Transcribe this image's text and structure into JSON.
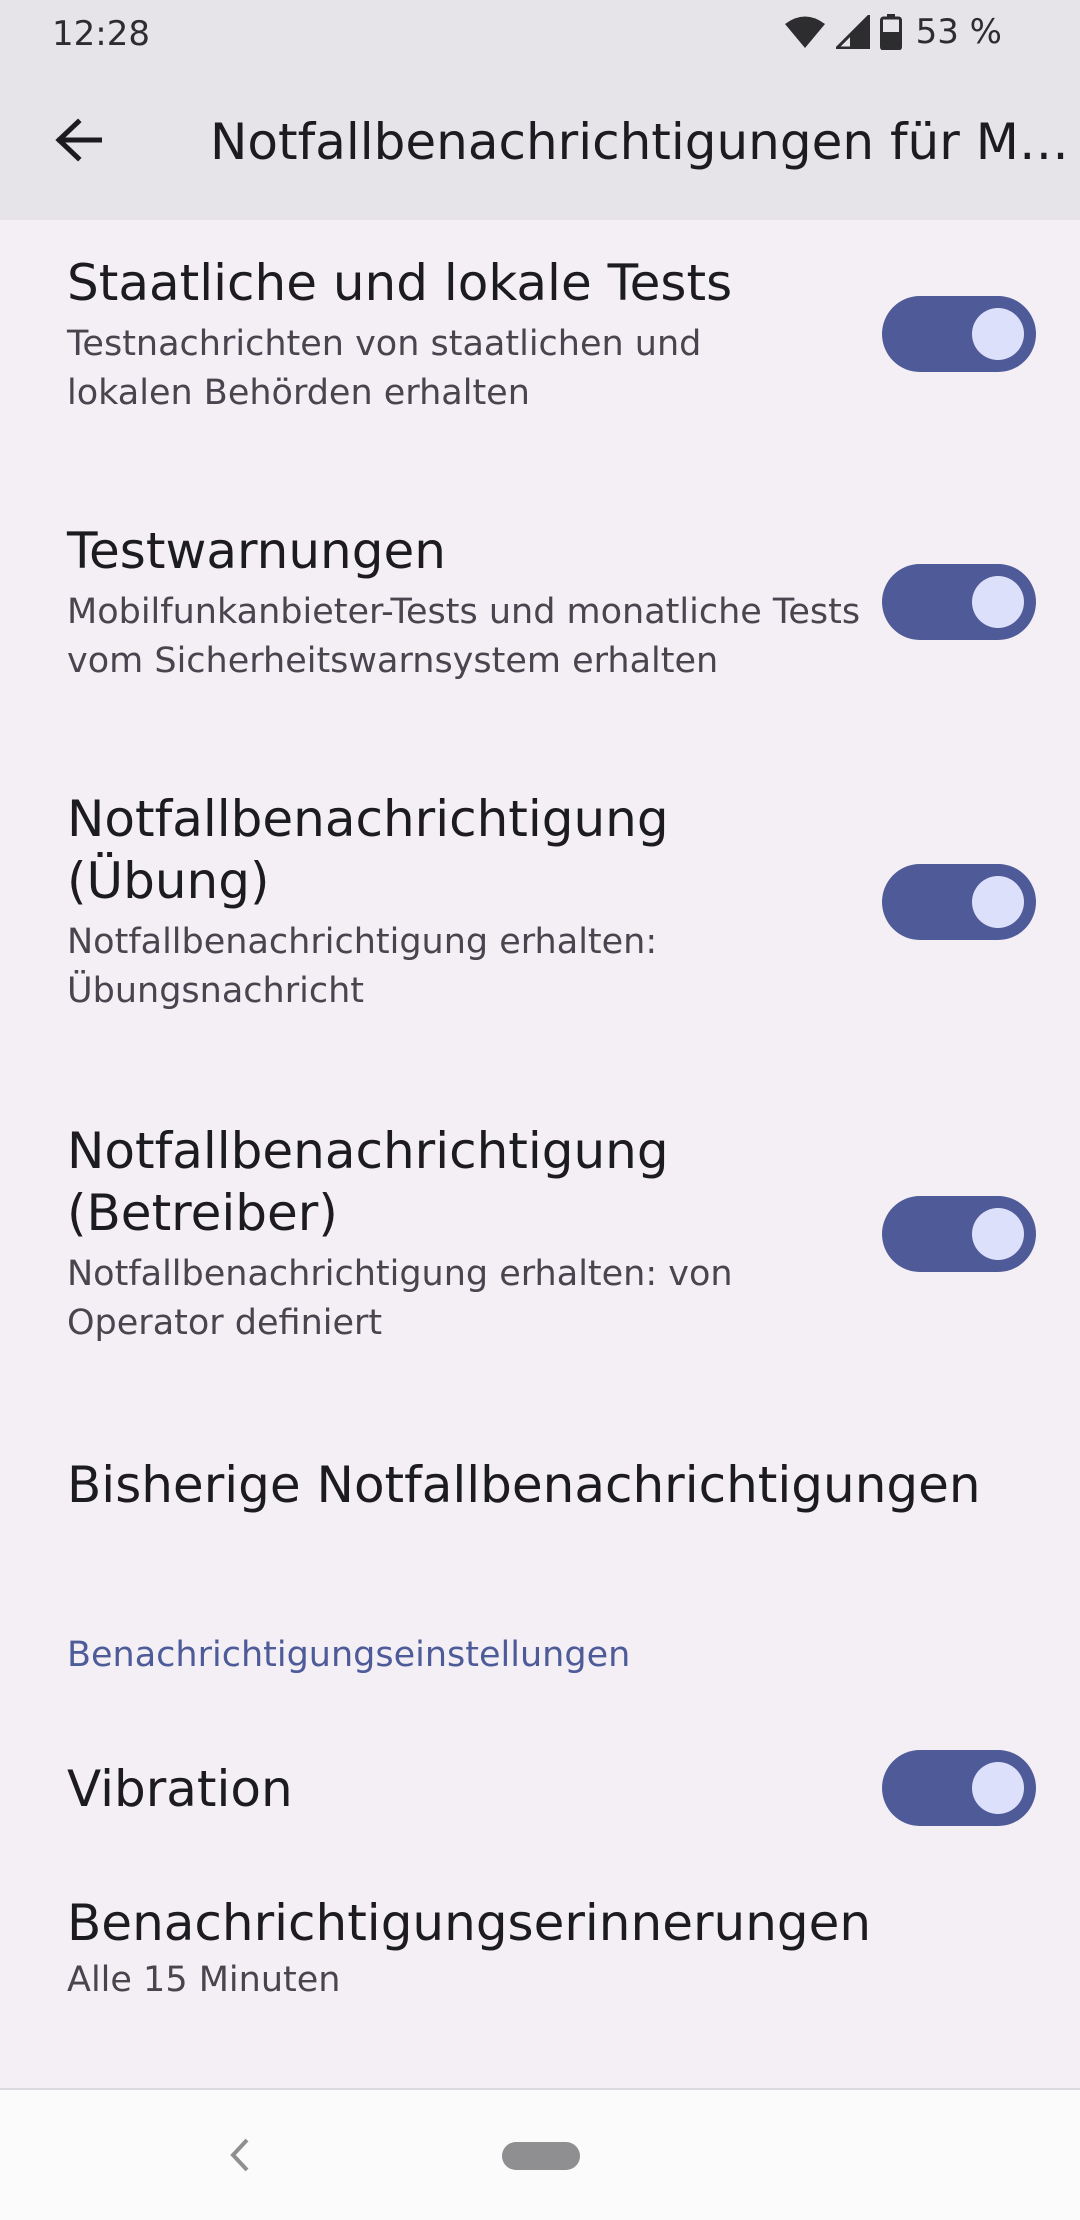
{
  "status_bar": {
    "time": "12:28",
    "battery_percent": "53 %",
    "icons": [
      "wifi-icon",
      "cell-signal-icon",
      "battery-icon"
    ]
  },
  "app_bar": {
    "back_icon": "arrow-left-icon",
    "title": "Notfallbenachrichtigungen für Mo…"
  },
  "preferences": [
    {
      "title": "Staatliche und lokale Tests",
      "summary": "Testnachrichten von staatlichen und lokalen Behörden erhalten",
      "switch_on": true
    },
    {
      "title": "Testwarnungen",
      "summary": "Mobilfunkanbieter-Tests und monatliche Tests vom Sicherheitswarnsystem erhalten",
      "switch_on": true
    },
    {
      "title": "Notfallbenachrichtigung (Übung)",
      "summary": "Notfallbenachrichtigung erhalten: Übungsnachricht",
      "switch_on": true
    },
    {
      "title": "Notfallbenachrichtigung (Betreiber)",
      "summary": "Notfallbenachrichtigung erhalten: von Operator definiert",
      "switch_on": true
    }
  ],
  "history_item": {
    "title": "Bisherige Notfallbenachrichtigungen"
  },
  "category": {
    "title": "Benachrichtigungseinstellungen"
  },
  "vibration": {
    "title": "Vibration",
    "switch_on": true
  },
  "reminders": {
    "title": "Benachrichtigungserinnerungen",
    "summary": "Alle 15 Minuten"
  },
  "colors": {
    "switch_track": "#4f5b99",
    "switch_thumb": "#dde0fb",
    "accent": "#4e5b99",
    "background": "#f4eff5",
    "app_bar": "#e6e3e9"
  },
  "nav_bar": {
    "back_icon": "chevron-left-icon",
    "home_icon": "home-pill-icon"
  }
}
